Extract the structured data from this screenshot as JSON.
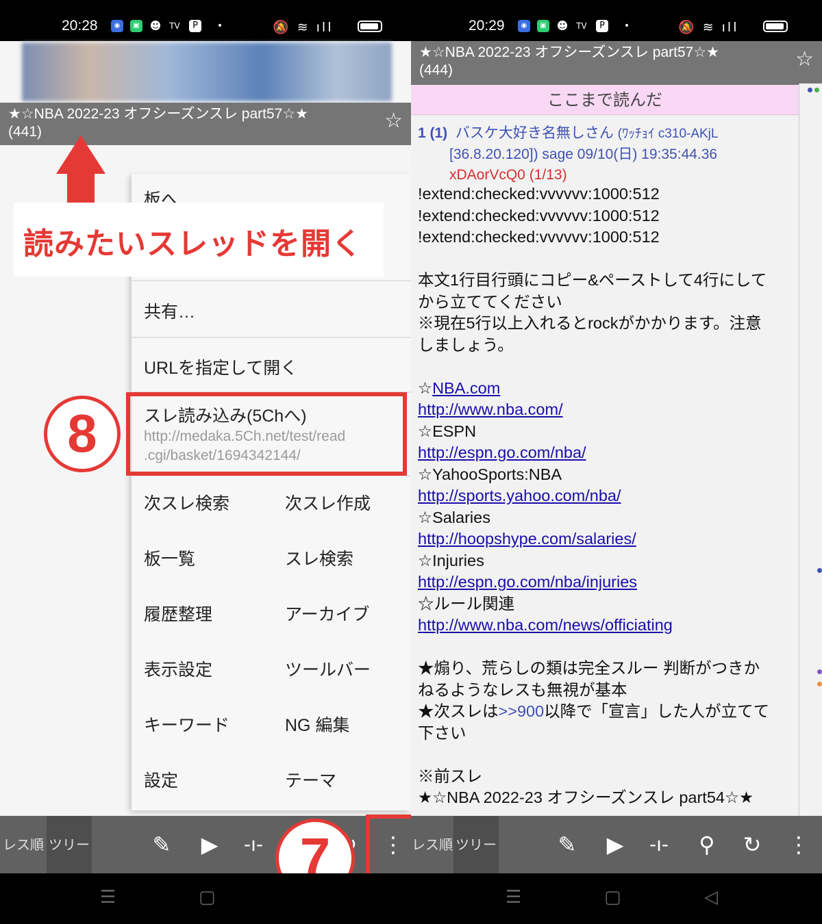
{
  "left": {
    "status": {
      "time": "20:28"
    },
    "thread_title": "★☆NBA 2022-23 オフシーズンスレ part57☆★",
    "thread_count": "(441)",
    "callout": "読みたいスレッドを開く",
    "menu": {
      "to_board": "板へ",
      "share": "共有…",
      "open_url": "URLを指定して開く",
      "reload_label": "スレ読み込み(5Chへ)",
      "reload_url_1": "http://medaka.5Ch.net/test/read",
      "reload_url_2": ".cgi/basket/1694342144/",
      "grid": [
        [
          "次スレ検索",
          "次スレ作成"
        ],
        [
          "板一覧",
          "スレ検索"
        ],
        [
          "履歴整理",
          "アーカイブ"
        ],
        [
          "表示設定",
          "ツールバー"
        ],
        [
          "キーワード",
          "NG 編集"
        ],
        [
          "設定",
          "テーマ"
        ]
      ]
    },
    "badge_8": "8",
    "badge_7": "7"
  },
  "right": {
    "status": {
      "time": "20:29"
    },
    "thread_title": "★☆NBA 2022-23 オフシーズンスレ part57☆★",
    "thread_count": "(444)",
    "here_read": "ここまで読んだ",
    "post": {
      "num": "1 (1)",
      "name": "バスケ大好き名無しさん",
      "id_tag": "(ﾜｯﾁｮｲ c310-AKjL",
      "ip_date": "[36.8.20.120]) sage 09/10(日) 19:35:44.36",
      "uid": "xDAorVcQ0 (1/13)",
      "lines": {
        "l1": "!extend:checked:vvvvvv:1000:512",
        "l2": "!extend:checked:vvvvvv:1000:512",
        "l3": "!extend:checked:vvvvvv:1000:512",
        "p1a": "本文1行目行頭にコピー&ペーストして4行にして",
        "p1b": "から立ててください",
        "p1c": "※現在5行以上入れるとrockがかかります。注意",
        "p1d": "しましょう。",
        "s1": "☆",
        "s1link": "NBA.com",
        "u1": "http://www.nba.com/",
        "s2": "☆ESPN",
        "u2": "http://espn.go.com/nba/",
        "s3": "☆YahooSports:NBA",
        "u3": "http://sports.yahoo.com/nba/",
        "s4": "☆Salaries",
        "u4": "http://hoopshype.com/salaries/",
        "s5": "☆Injuries",
        "u5": "http://espn.go.com/nba/injuries",
        "s6": "☆ルール関連",
        "u6": "http://www.nba.com/news/officiating",
        "r1": "★煽り、荒らしの類は完全スルー 判断がつきか",
        "r2": "ねるようなレスも無視が基本",
        "r3a": "★次スレは",
        "r3anchor": ">>900",
        "r3b": "以降で「宣言」した人が立てて",
        "r4": "下さい",
        "prev": "※前スレ",
        "prev_title": "★☆NBA 2022-23 オフシーズンスレ part54☆★"
      }
    }
  },
  "toolbar": {
    "tab_order": "レス順",
    "tab_tree": "ツリー"
  },
  "colors": {
    "accent_red": "#e53935",
    "titlebar": "#757575",
    "toolbar": "#616161",
    "here_read_bg": "#f8d8f5"
  },
  "icons": [
    "edit-icon",
    "play-icon",
    "slider-icon",
    "search-icon",
    "reload-icon",
    "more-vert-icon",
    "star-icon"
  ]
}
